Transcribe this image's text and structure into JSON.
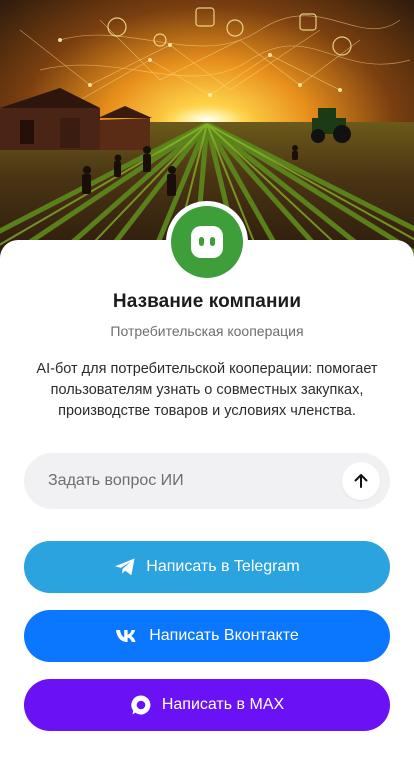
{
  "company": {
    "name": "Название компании",
    "type": "Потребительская кооперация",
    "description": "AI-бот для потребительской кооперации: помогает пользователям узнать о совместных закупках, производстве товаров и условиях членства."
  },
  "ask": {
    "placeholder": "Задать вопрос ИИ",
    "value": ""
  },
  "buttons": {
    "telegram": {
      "label": "Написать в Telegram",
      "color": "#2aa3df",
      "icon": "telegram-icon"
    },
    "vk": {
      "label": "Написать Вконтакте",
      "color": "#0b77ff",
      "icon": "vk-icon"
    },
    "max": {
      "label": "Написать в MAX",
      "color": "#6a12f5",
      "icon": "max-icon"
    }
  },
  "colors": {
    "avatar": "#3e9e3a",
    "ask_background": "#f1f1f3"
  }
}
